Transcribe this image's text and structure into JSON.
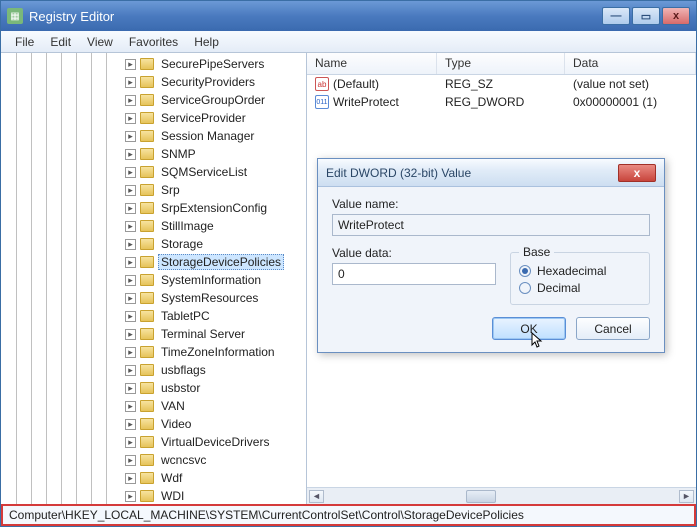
{
  "window": {
    "title": "Registry Editor",
    "buttons": {
      "min": "—",
      "max": "▭",
      "close": "x"
    }
  },
  "menubar": [
    "File",
    "Edit",
    "View",
    "Favorites",
    "Help"
  ],
  "tree": {
    "items": [
      {
        "label": "SecurePipeServers",
        "sel": false
      },
      {
        "label": "SecurityProviders",
        "sel": false
      },
      {
        "label": "ServiceGroupOrder",
        "sel": false
      },
      {
        "label": "ServiceProvider",
        "sel": false
      },
      {
        "label": "Session Manager",
        "sel": false
      },
      {
        "label": "SNMP",
        "sel": false
      },
      {
        "label": "SQMServiceList",
        "sel": false
      },
      {
        "label": "Srp",
        "sel": false
      },
      {
        "label": "SrpExtensionConfig",
        "sel": false
      },
      {
        "label": "StillImage",
        "sel": false
      },
      {
        "label": "Storage",
        "sel": false
      },
      {
        "label": "StorageDevicePolicies",
        "sel": true
      },
      {
        "label": "SystemInformation",
        "sel": false
      },
      {
        "label": "SystemResources",
        "sel": false
      },
      {
        "label": "TabletPC",
        "sel": false
      },
      {
        "label": "Terminal Server",
        "sel": false
      },
      {
        "label": "TimeZoneInformation",
        "sel": false
      },
      {
        "label": "usbflags",
        "sel": false
      },
      {
        "label": "usbstor",
        "sel": false
      },
      {
        "label": "VAN",
        "sel": false
      },
      {
        "label": "Video",
        "sel": false
      },
      {
        "label": "VirtualDeviceDrivers",
        "sel": false
      },
      {
        "label": "wcncsvc",
        "sel": false
      },
      {
        "label": "Wdf",
        "sel": false
      },
      {
        "label": "WDI",
        "sel": false
      }
    ]
  },
  "list": {
    "headers": {
      "name": "Name",
      "type": "Type",
      "data": "Data"
    },
    "rows": [
      {
        "icon": "str",
        "name": "(Default)",
        "type": "REG_SZ",
        "data": "(value not set)"
      },
      {
        "icon": "dw",
        "name": "WriteProtect",
        "type": "REG_DWORD",
        "data": "0x00000001 (1)"
      }
    ]
  },
  "statusbar": {
    "path": "Computer\\HKEY_LOCAL_MACHINE\\SYSTEM\\CurrentControlSet\\Control\\StorageDevicePolicies"
  },
  "dialog": {
    "title": "Edit DWORD (32-bit) Value",
    "value_name_label": "Value name:",
    "value_name": "WriteProtect",
    "value_data_label": "Value data:",
    "value_data": "0",
    "base_label": "Base",
    "hex_label": "Hexadecimal",
    "dec_label": "Decimal",
    "base_selected": "hex",
    "ok": "OK",
    "cancel": "Cancel",
    "close": "x"
  }
}
